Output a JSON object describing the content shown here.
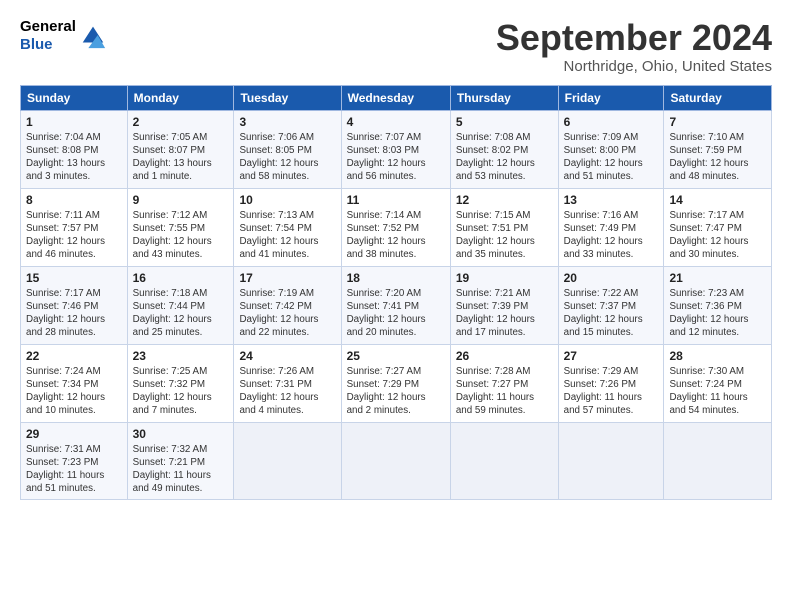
{
  "header": {
    "logo_line1": "General",
    "logo_line2": "Blue",
    "month": "September 2024",
    "location": "Northridge, Ohio, United States"
  },
  "days_of_week": [
    "Sunday",
    "Monday",
    "Tuesday",
    "Wednesday",
    "Thursday",
    "Friday",
    "Saturday"
  ],
  "weeks": [
    [
      {
        "num": "1",
        "sunrise": "7:04 AM",
        "sunset": "8:08 PM",
        "daylight": "13 hours and 3 minutes."
      },
      {
        "num": "2",
        "sunrise": "7:05 AM",
        "sunset": "8:07 PM",
        "daylight": "13 hours and 1 minute."
      },
      {
        "num": "3",
        "sunrise": "7:06 AM",
        "sunset": "8:05 PM",
        "daylight": "12 hours and 58 minutes."
      },
      {
        "num": "4",
        "sunrise": "7:07 AM",
        "sunset": "8:03 PM",
        "daylight": "12 hours and 56 minutes."
      },
      {
        "num": "5",
        "sunrise": "7:08 AM",
        "sunset": "8:02 PM",
        "daylight": "12 hours and 53 minutes."
      },
      {
        "num": "6",
        "sunrise": "7:09 AM",
        "sunset": "8:00 PM",
        "daylight": "12 hours and 51 minutes."
      },
      {
        "num": "7",
        "sunrise": "7:10 AM",
        "sunset": "7:59 PM",
        "daylight": "12 hours and 48 minutes."
      }
    ],
    [
      {
        "num": "8",
        "sunrise": "7:11 AM",
        "sunset": "7:57 PM",
        "daylight": "12 hours and 46 minutes."
      },
      {
        "num": "9",
        "sunrise": "7:12 AM",
        "sunset": "7:55 PM",
        "daylight": "12 hours and 43 minutes."
      },
      {
        "num": "10",
        "sunrise": "7:13 AM",
        "sunset": "7:54 PM",
        "daylight": "12 hours and 41 minutes."
      },
      {
        "num": "11",
        "sunrise": "7:14 AM",
        "sunset": "7:52 PM",
        "daylight": "12 hours and 38 minutes."
      },
      {
        "num": "12",
        "sunrise": "7:15 AM",
        "sunset": "7:51 PM",
        "daylight": "12 hours and 35 minutes."
      },
      {
        "num": "13",
        "sunrise": "7:16 AM",
        "sunset": "7:49 PM",
        "daylight": "12 hours and 33 minutes."
      },
      {
        "num": "14",
        "sunrise": "7:17 AM",
        "sunset": "7:47 PM",
        "daylight": "12 hours and 30 minutes."
      }
    ],
    [
      {
        "num": "15",
        "sunrise": "7:17 AM",
        "sunset": "7:46 PM",
        "daylight": "12 hours and 28 minutes."
      },
      {
        "num": "16",
        "sunrise": "7:18 AM",
        "sunset": "7:44 PM",
        "daylight": "12 hours and 25 minutes."
      },
      {
        "num": "17",
        "sunrise": "7:19 AM",
        "sunset": "7:42 PM",
        "daylight": "12 hours and 22 minutes."
      },
      {
        "num": "18",
        "sunrise": "7:20 AM",
        "sunset": "7:41 PM",
        "daylight": "12 hours and 20 minutes."
      },
      {
        "num": "19",
        "sunrise": "7:21 AM",
        "sunset": "7:39 PM",
        "daylight": "12 hours and 17 minutes."
      },
      {
        "num": "20",
        "sunrise": "7:22 AM",
        "sunset": "7:37 PM",
        "daylight": "12 hours and 15 minutes."
      },
      {
        "num": "21",
        "sunrise": "7:23 AM",
        "sunset": "7:36 PM",
        "daylight": "12 hours and 12 minutes."
      }
    ],
    [
      {
        "num": "22",
        "sunrise": "7:24 AM",
        "sunset": "7:34 PM",
        "daylight": "12 hours and 10 minutes."
      },
      {
        "num": "23",
        "sunrise": "7:25 AM",
        "sunset": "7:32 PM",
        "daylight": "12 hours and 7 minutes."
      },
      {
        "num": "24",
        "sunrise": "7:26 AM",
        "sunset": "7:31 PM",
        "daylight": "12 hours and 4 minutes."
      },
      {
        "num": "25",
        "sunrise": "7:27 AM",
        "sunset": "7:29 PM",
        "daylight": "12 hours and 2 minutes."
      },
      {
        "num": "26",
        "sunrise": "7:28 AM",
        "sunset": "7:27 PM",
        "daylight": "11 hours and 59 minutes."
      },
      {
        "num": "27",
        "sunrise": "7:29 AM",
        "sunset": "7:26 PM",
        "daylight": "11 hours and 57 minutes."
      },
      {
        "num": "28",
        "sunrise": "7:30 AM",
        "sunset": "7:24 PM",
        "daylight": "11 hours and 54 minutes."
      }
    ],
    [
      {
        "num": "29",
        "sunrise": "7:31 AM",
        "sunset": "7:23 PM",
        "daylight": "11 hours and 51 minutes."
      },
      {
        "num": "30",
        "sunrise": "7:32 AM",
        "sunset": "7:21 PM",
        "daylight": "11 hours and 49 minutes."
      },
      null,
      null,
      null,
      null,
      null
    ]
  ]
}
